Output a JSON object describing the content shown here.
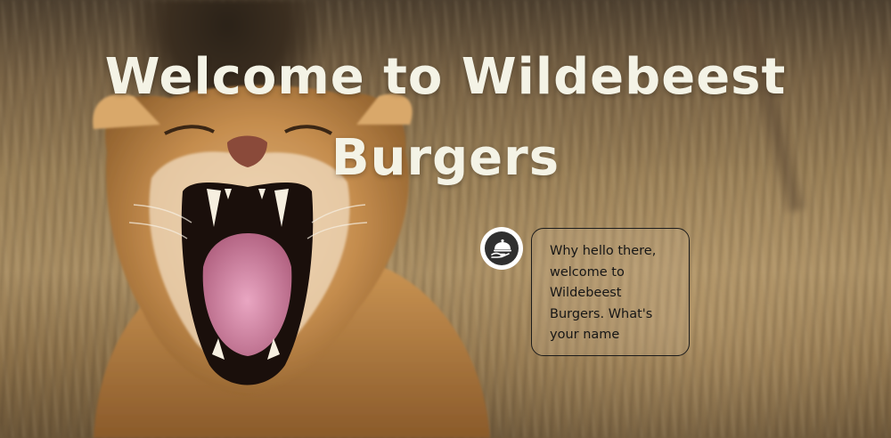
{
  "hero": {
    "title": "Welcome to Wildebeest Burgers"
  },
  "chat": {
    "avatar_icon": "serving-cloche-icon",
    "message": "Why hello there, welcome to Wildebeest Burgers. What's your name"
  },
  "colors": {
    "title": "#f4f3e6",
    "bubble_border": "#1b1b1b",
    "avatar_bg": "#2f2f2f"
  }
}
